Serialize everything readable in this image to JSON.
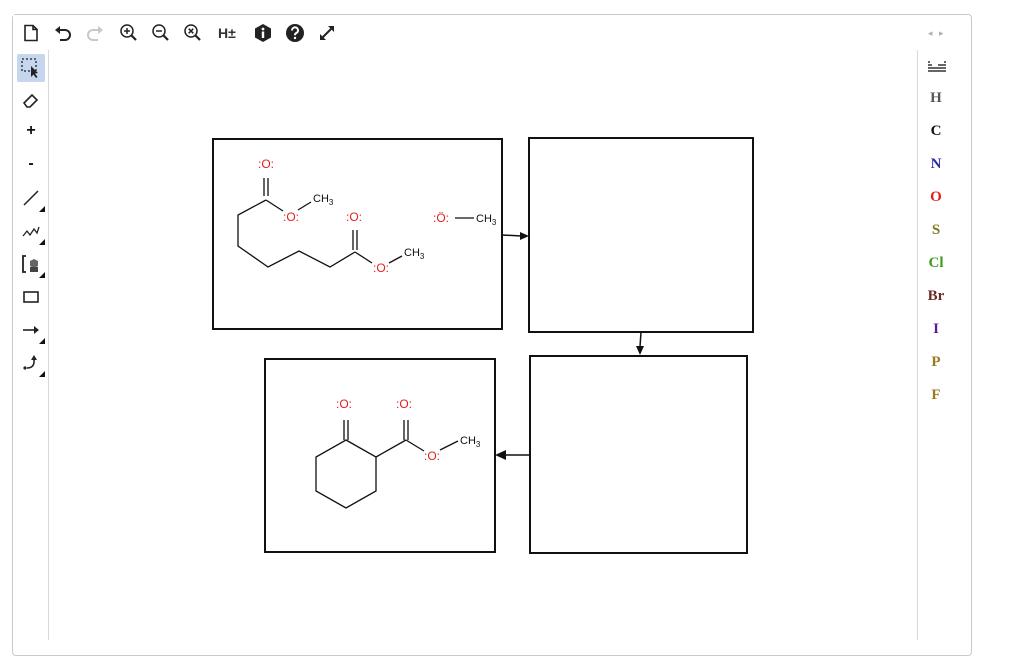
{
  "toolbar": {
    "buttons": [
      {
        "name": "new-document-button",
        "icon": "document-icon"
      },
      {
        "name": "undo-button",
        "icon": "undo-icon"
      },
      {
        "name": "redo-button",
        "icon": "redo-icon"
      },
      {
        "name": "zoom-in-button",
        "icon": "zoom-in-icon"
      },
      {
        "name": "zoom-out-button",
        "icon": "zoom-out-icon"
      },
      {
        "name": "zoom-reset-button",
        "icon": "zoom-reset-icon"
      },
      {
        "name": "hydrogens-toggle-button",
        "icon": "hydrogen-toggle-icon"
      },
      {
        "name": "info-button",
        "icon": "info-icon"
      },
      {
        "name": "help-button",
        "icon": "help-icon"
      },
      {
        "name": "fullscreen-button",
        "icon": "expand-icon"
      }
    ],
    "hydrogen_label": "H±"
  },
  "tools": [
    {
      "name": "select-tool",
      "icon": "lasso-select-icon",
      "active": true
    },
    {
      "name": "eraser-tool",
      "icon": "eraser-icon"
    },
    {
      "name": "charge-plus-tool",
      "label": "+"
    },
    {
      "name": "charge-minus-tool",
      "label": "-"
    },
    {
      "name": "bond-tool",
      "icon": "single-bond-icon"
    },
    {
      "name": "chain-tool",
      "icon": "chain-icon"
    },
    {
      "name": "template-tool",
      "icon": "bracket-template-icon"
    },
    {
      "name": "shape-tool",
      "icon": "rectangle-icon"
    },
    {
      "name": "reaction-arrow-tool",
      "icon": "arrow-icon"
    },
    {
      "name": "curved-arrow-tool",
      "icon": "curved-arrow-icon"
    }
  ],
  "periodic_icon": "periodic-table-icon",
  "elements": [
    {
      "symbol": "H",
      "color": "#555555"
    },
    {
      "symbol": "C",
      "color": "#111111"
    },
    {
      "symbol": "N",
      "color": "#2c2cae"
    },
    {
      "symbol": "O",
      "color": "#e02020"
    },
    {
      "symbol": "S",
      "color": "#7b7b1c"
    },
    {
      "symbol": "Cl",
      "color": "#3b9b1c"
    },
    {
      "symbol": "Br",
      "color": "#6b2a2a"
    },
    {
      "symbol": "I",
      "color": "#5a1a9a"
    },
    {
      "symbol": "P",
      "color": "#9b7a1c"
    },
    {
      "symbol": "F",
      "color": "#9b7a1c"
    }
  ],
  "canvas": {
    "atom_colors": {
      "oxygen": "#e02020",
      "bond": "#111111"
    },
    "labels": {
      "oxygen": "O",
      "methyl": "CH",
      "methyl_sub": "3",
      "lone_pair": ":"
    }
  }
}
